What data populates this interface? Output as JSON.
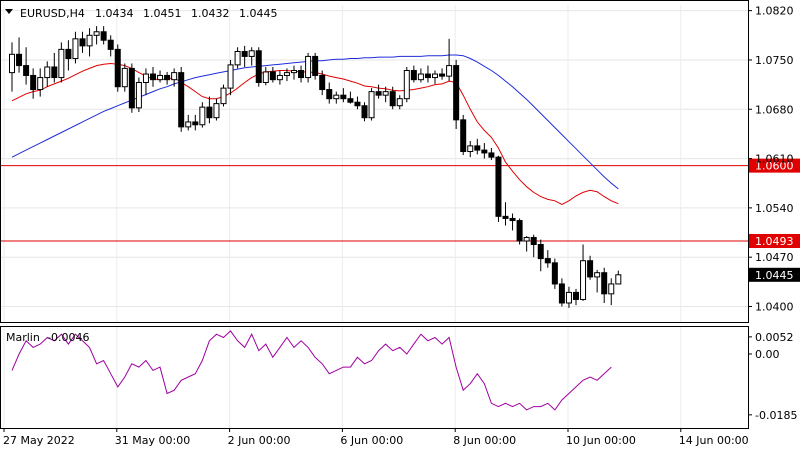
{
  "chart_data": {
    "type": "candlestick",
    "header": {
      "dropdown_icon": "triangle-down-icon",
      "symbol": "EURUSD,H4",
      "o": "1.0434",
      "h": "1.0451",
      "l": "1.0432",
      "c": "1.0445"
    },
    "price_axis": {
      "ylim": [
        1.0378,
        1.0828
      ],
      "ticks": [
        "1.0820",
        "1.0750",
        "1.0680",
        "1.0610",
        "1.0540",
        "1.0470",
        "1.0400"
      ]
    },
    "x_labels": [
      "27 May 2022",
      "31 May 00:00",
      "2 Jun 00:00",
      "6 Jun 00:00",
      "8 Jun 00:00",
      "10 Jun 00:00",
      "14 Jun 00:00"
    ],
    "x_label_index": [
      0,
      16,
      32,
      48,
      64,
      80,
      96
    ],
    "levels": [
      {
        "name": "resistance-1",
        "value": 1.06,
        "label": "1.0600",
        "color": "#e00000"
      },
      {
        "name": "resistance-2",
        "value": 1.0493,
        "label": "1.0493",
        "color": "#e00000"
      }
    ],
    "current_price": {
      "value": 1.0445,
      "label": "1.0445"
    },
    "candles": [
      [
        1.0732,
        1.0775,
        1.0705,
        1.0758
      ],
      [
        1.0758,
        1.0782,
        1.0732,
        1.0742
      ],
      [
        1.0742,
        1.0768,
        1.0715,
        1.0728
      ],
      [
        1.0728,
        1.0738,
        1.0695,
        1.0708
      ],
      [
        1.0708,
        1.0738,
        1.0698,
        1.0725
      ],
      [
        1.0725,
        1.0748,
        1.0712,
        1.074
      ],
      [
        1.074,
        1.076,
        1.0718,
        1.0725
      ],
      [
        1.0725,
        1.0775,
        1.0718,
        1.0765
      ],
      [
        1.0765,
        1.0778,
        1.0735,
        1.0752
      ],
      [
        1.0752,
        1.079,
        1.0745,
        1.078
      ],
      [
        1.078,
        1.079,
        1.076,
        1.077
      ],
      [
        1.077,
        1.0795,
        1.0755,
        1.0785
      ],
      [
        1.0785,
        1.0798,
        1.0772,
        1.079
      ],
      [
        1.079,
        1.0798,
        1.0772,
        1.0778
      ],
      [
        1.0778,
        1.0785,
        1.0755,
        1.0765
      ],
      [
        1.0765,
        1.0772,
        1.0705,
        1.0712
      ],
      [
        1.0712,
        1.0745,
        1.0705,
        1.0738
      ],
      [
        1.0738,
        1.0745,
        1.0675,
        1.0682
      ],
      [
        1.0682,
        1.0725,
        1.0676,
        1.0718
      ],
      [
        1.0718,
        1.0738,
        1.07,
        1.073
      ],
      [
        1.073,
        1.074,
        1.0712,
        1.0722
      ],
      [
        1.0722,
        1.0735,
        1.0718,
        1.0728
      ],
      [
        1.0728,
        1.0733,
        1.0715,
        1.0722
      ],
      [
        1.0722,
        1.0738,
        1.0712,
        1.0732
      ],
      [
        1.0732,
        1.074,
        1.0648,
        1.0655
      ],
      [
        1.0655,
        1.0672,
        1.065,
        1.0662
      ],
      [
        1.0662,
        1.0672,
        1.065,
        1.0658
      ],
      [
        1.0658,
        1.069,
        1.0654,
        1.0683
      ],
      [
        1.0683,
        1.0698,
        1.066,
        1.0668
      ],
      [
        1.0668,
        1.0695,
        1.0664,
        1.0688
      ],
      [
        1.0688,
        1.0715,
        1.0684,
        1.071
      ],
      [
        1.071,
        1.075,
        1.07,
        1.0743
      ],
      [
        1.0743,
        1.0768,
        1.0738,
        1.0762
      ],
      [
        1.0762,
        1.077,
        1.074,
        1.0755
      ],
      [
        1.0755,
        1.0768,
        1.0742,
        1.0763
      ],
      [
        1.0763,
        1.0768,
        1.0712,
        1.0718
      ],
      [
        1.0718,
        1.074,
        1.0714,
        1.0733
      ],
      [
        1.0733,
        1.074,
        1.0718,
        1.0722
      ],
      [
        1.0722,
        1.0735,
        1.0715,
        1.0728
      ],
      [
        1.0728,
        1.0738,
        1.072,
        1.0732
      ],
      [
        1.0732,
        1.0742,
        1.0722,
        1.0735
      ],
      [
        1.0735,
        1.0742,
        1.0718,
        1.0725
      ],
      [
        1.0725,
        1.076,
        1.0718,
        1.0755
      ],
      [
        1.0755,
        1.076,
        1.0722,
        1.0728
      ],
      [
        1.0728,
        1.0735,
        1.07,
        1.0708
      ],
      [
        1.0708,
        1.0718,
        1.0688,
        1.0695
      ],
      [
        1.0695,
        1.0705,
        1.0688,
        1.07
      ],
      [
        1.07,
        1.071,
        1.069,
        1.0695
      ],
      [
        1.0695,
        1.0705,
        1.0688,
        1.069
      ],
      [
        1.069,
        1.0698,
        1.068,
        1.0685
      ],
      [
        1.0685,
        1.069,
        1.0663,
        1.0668
      ],
      [
        1.0668,
        1.071,
        1.0664,
        1.0705
      ],
      [
        1.0705,
        1.0715,
        1.0695,
        1.07
      ],
      [
        1.07,
        1.0712,
        1.069,
        1.0705
      ],
      [
        1.0705,
        1.0712,
        1.068,
        1.0685
      ],
      [
        1.0685,
        1.07,
        1.068,
        1.0695
      ],
      [
        1.0695,
        1.074,
        1.069,
        1.0735
      ],
      [
        1.0735,
        1.0742,
        1.0718,
        1.0722
      ],
      [
        1.0722,
        1.0738,
        1.0718,
        1.073
      ],
      [
        1.073,
        1.0742,
        1.0718,
        1.0725
      ],
      [
        1.0725,
        1.0735,
        1.0716,
        1.073
      ],
      [
        1.073,
        1.0738,
        1.0722,
        1.0727
      ],
      [
        1.0727,
        1.078,
        1.072,
        1.0742
      ],
      [
        1.0742,
        1.075,
        1.0652,
        1.0665
      ],
      [
        1.0665,
        1.0672,
        1.0615,
        1.062
      ],
      [
        1.062,
        1.0635,
        1.0612,
        1.0628
      ],
      [
        1.0628,
        1.0638,
        1.0616,
        1.0622
      ],
      [
        1.0622,
        1.0632,
        1.061,
        1.0618
      ],
      [
        1.0618,
        1.0625,
        1.0608,
        1.0612
      ],
      [
        1.0612,
        1.0614,
        1.052,
        1.0528
      ],
      [
        1.0528,
        1.0548,
        1.0515,
        1.0525
      ],
      [
        1.0525,
        1.0532,
        1.0508,
        1.0522
      ],
      [
        1.0522,
        1.0525,
        1.0488,
        1.0493
      ],
      [
        1.0493,
        1.05,
        1.0478,
        1.0498
      ],
      [
        1.0498,
        1.0502,
        1.047,
        1.0488
      ],
      [
        1.0488,
        1.0495,
        1.045,
        1.0468
      ],
      [
        1.0468,
        1.048,
        1.0455,
        1.0462
      ],
      [
        1.0462,
        1.0468,
        1.0425,
        1.0432
      ],
      [
        1.0432,
        1.044,
        1.04,
        1.0405
      ],
      [
        1.0405,
        1.0428,
        1.0398,
        1.042
      ],
      [
        1.042,
        1.0425,
        1.0402,
        1.041
      ],
      [
        1.041,
        1.0488,
        1.0408,
        1.0465
      ],
      [
        1.0465,
        1.0472,
        1.0438,
        1.0442
      ],
      [
        1.0442,
        1.0452,
        1.042,
        1.0448
      ],
      [
        1.0448,
        1.0455,
        1.0405,
        1.0418
      ],
      [
        1.0418,
        1.044,
        1.0402,
        1.0432
      ],
      [
        1.0432,
        1.0451,
        1.0432,
        1.0445
      ]
    ],
    "ma_red": [
      1.0692,
      1.0697,
      1.0702,
      1.0705,
      1.0707,
      1.0712,
      1.0716,
      1.072,
      1.0724,
      1.0729,
      1.0734,
      1.0738,
      1.0742,
      1.0744,
      1.0745,
      1.0744,
      1.0742,
      1.0738,
      1.0732,
      1.0727,
      1.0723,
      1.0722,
      1.0723,
      1.0725,
      1.0718,
      1.0712,
      1.0705,
      1.0698,
      1.0695,
      1.0695,
      1.0698,
      1.0703,
      1.071,
      1.0718,
      1.0725,
      1.073,
      1.0733,
      1.0734,
      1.0735,
      1.0735,
      1.0734,
      1.0733,
      1.0733,
      1.0732,
      1.073,
      1.0727,
      1.0725,
      1.0723,
      1.072,
      1.0717,
      1.0713,
      1.0712,
      1.071,
      1.0709,
      1.0707,
      1.0706,
      1.0707,
      1.0708,
      1.071,
      1.0712,
      1.0715,
      1.0716,
      1.072,
      1.0718,
      1.07,
      1.068,
      1.0662,
      1.065,
      1.064,
      1.0625,
      1.0605,
      1.0592,
      1.058,
      1.057,
      1.0562,
      1.0556,
      1.0552,
      1.055,
      1.0545,
      1.055,
      1.0557,
      1.0562,
      1.0565,
      1.0563,
      1.0556,
      1.055,
      1.0546
    ],
    "ma_blue": [
      1.0612,
      1.0617,
      1.0622,
      1.0627,
      1.0632,
      1.0637,
      1.0642,
      1.0647,
      1.0652,
      1.0657,
      1.0662,
      1.0667,
      1.0672,
      1.0677,
      1.0681,
      1.0685,
      1.0689,
      1.0693,
      1.0697,
      1.0701,
      1.0705,
      1.0709,
      1.0712,
      1.0716,
      1.0719,
      1.0722,
      1.0725,
      1.0727,
      1.0729,
      1.0731,
      1.0733,
      1.0735,
      1.0737,
      1.0739,
      1.074,
      1.0741,
      1.0742,
      1.0743,
      1.0744,
      1.0745,
      1.0746,
      1.0747,
      1.0748,
      1.0749,
      1.0749,
      1.075,
      1.0751,
      1.0751,
      1.0752,
      1.0752,
      1.0753,
      1.0753,
      1.0754,
      1.0754,
      1.0754,
      1.0755,
      1.0755,
      1.0755,
      1.0755,
      1.0756,
      1.0756,
      1.0756,
      1.0757,
      1.0757,
      1.0756,
      1.0752,
      1.0747,
      1.0741,
      1.0735,
      1.0728,
      1.072,
      1.0712,
      1.0703,
      1.0694,
      1.0684,
      1.0674,
      1.0664,
      1.0654,
      1.0644,
      1.0634,
      1.0624,
      1.0614,
      1.0604,
      1.0594,
      1.0584,
      1.0575,
      1.0567
    ],
    "oscillator": {
      "label": "Marlin",
      "value_label": "-0.0046",
      "ylim": [
        -0.0225,
        0.0085
      ],
      "ticks": [
        "0.0052",
        "0.00",
        "-0.0185"
      ],
      "color": "#a000a0",
      "values": [
        -0.005,
        0.0,
        0.004,
        0.002,
        0.003,
        0.005,
        0.004,
        0.006,
        0.003,
        0.006,
        0.004,
        0.002,
        -0.003,
        -0.002,
        -0.006,
        -0.01,
        -0.007,
        -0.003,
        -0.004,
        -0.002,
        -0.005,
        -0.004,
        -0.012,
        -0.011,
        -0.008,
        -0.007,
        -0.006,
        -0.002,
        0.004,
        0.006,
        0.005,
        0.007,
        0.004,
        0.002,
        0.006,
        0.001,
        0.003,
        -0.001,
        0.002,
        0.005,
        0.002,
        0.004,
        0.002,
        -0.001,
        -0.003,
        -0.006,
        -0.005,
        -0.004,
        -0.004,
        -0.001,
        -0.003,
        -0.002,
        0.001,
        0.003,
        0.001,
        0.002,
        0.0,
        0.003,
        0.006,
        0.004,
        0.005,
        0.003,
        0.005,
        -0.004,
        -0.011,
        -0.009,
        -0.006,
        -0.009,
        -0.015,
        -0.016,
        -0.015,
        -0.016,
        -0.015,
        -0.017,
        -0.016,
        -0.016,
        -0.015,
        -0.017,
        -0.014,
        -0.012,
        -0.01,
        -0.008,
        -0.007,
        -0.008,
        -0.006,
        -0.004
      ]
    }
  }
}
